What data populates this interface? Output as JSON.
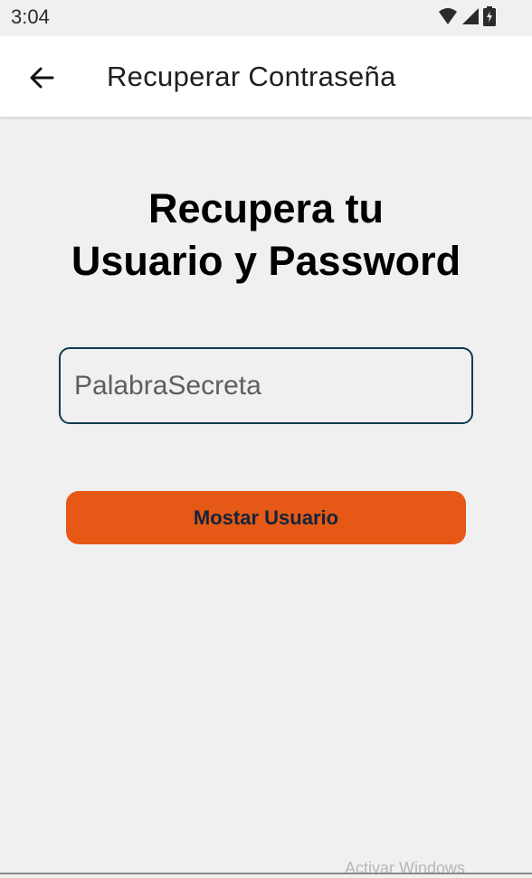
{
  "status_bar": {
    "time": "3:04",
    "icons": [
      "wifi-icon",
      "cell-signal-icon",
      "battery-icon"
    ]
  },
  "app_bar": {
    "back_icon": "arrow-left-icon",
    "title": "Recuperar Contraseña"
  },
  "main": {
    "headline_line1": "Recupera tu",
    "headline_line2": "Usuario y Password",
    "secret_input": {
      "placeholder": "PalabraSecreta",
      "value": ""
    },
    "submit_label": "Mostar Usuario"
  },
  "overlay": {
    "watermark": "Activar Windows"
  },
  "colors": {
    "background": "#f1f0f0",
    "app_bar": "#ffffff",
    "accent_button": "#e65815",
    "button_text": "#12253a",
    "input_border": "#0e3b53"
  }
}
